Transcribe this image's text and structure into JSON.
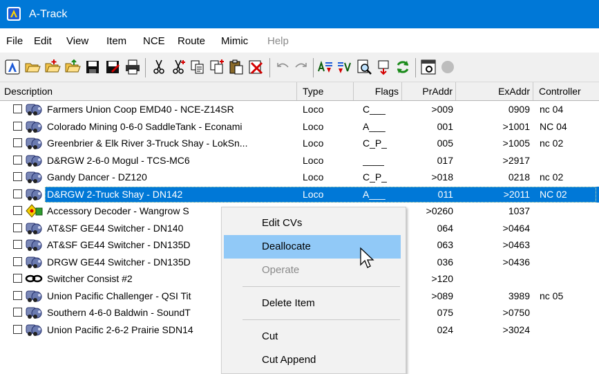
{
  "window": {
    "title": "A-Track"
  },
  "menu": [
    {
      "label": "File",
      "enabled": true
    },
    {
      "label": "Edit",
      "enabled": true
    },
    {
      "label": "View",
      "enabled": true
    },
    {
      "label": "Item",
      "enabled": true
    },
    {
      "label": "NCE",
      "enabled": true
    },
    {
      "label": "Route",
      "enabled": true
    },
    {
      "label": "Mimic",
      "enabled": true
    },
    {
      "label": "Help",
      "enabled": false
    }
  ],
  "toolbar": {
    "icons": [
      "app-icon",
      "open-folder-icon",
      "open-folder-add-icon",
      "open-folder-up-icon",
      "save-icon",
      "save-as-icon",
      "print-icon",
      "cut-icon",
      "cut-append-icon",
      "copy-icon",
      "copy-append-icon",
      "paste-icon",
      "delete-icon",
      "undo-icon",
      "redo-icon",
      "allocate-icon",
      "deallocate-icon",
      "find-icon",
      "locate-icon",
      "refresh-icon",
      "properties-icon",
      "status-icon"
    ]
  },
  "columns": {
    "description": "Description",
    "type": "Type",
    "flags": "Flags",
    "praddr": "PrAddr",
    "exaddr": "ExAddr",
    "controller": "Controller"
  },
  "rows": [
    {
      "icon": "locomotive-icon",
      "description": "Farmers Union Coop EMD40 - NCE-Z14SR",
      "type": "Loco",
      "flags": "C___",
      "praddr": ">009",
      "exaddr": "0909",
      "controller": "nc 04"
    },
    {
      "icon": "locomotive-icon",
      "description": "Colorado Mining 0-6-0 SaddleTank - Econami",
      "type": "Loco",
      "flags": "A___",
      "praddr": "001",
      "exaddr": ">1001",
      "controller": "NC 04"
    },
    {
      "icon": "locomotive-icon",
      "description": "Greenbrier & Elk River 3-Truck Shay - LokSn...",
      "type": "Loco",
      "flags": "C_P_",
      "praddr": "005",
      "exaddr": ">1005",
      "controller": "nc 02"
    },
    {
      "icon": "locomotive-icon",
      "description": "D&RGW 2-6-0 Mogul - TCS-MC6",
      "type": "Loco",
      "flags": "____",
      "praddr": "017",
      "exaddr": ">2917",
      "controller": ""
    },
    {
      "icon": "locomotive-icon",
      "description": "Gandy Dancer - DZ120",
      "type": "Loco",
      "flags": "C_P_",
      "praddr": ">018",
      "exaddr": "0218",
      "controller": "nc 02"
    },
    {
      "icon": "locomotive-icon",
      "description": "D&RGW 2-Truck Shay - DN142",
      "type": "Loco",
      "flags": "A___",
      "praddr": "011",
      "exaddr": ">2011",
      "controller": "NC 02",
      "selected": true
    },
    {
      "icon": "accessory-decoder-icon",
      "description": "Accessory Decoder - Wangrow S",
      "type": "",
      "flags": "",
      "praddr": ">0260",
      "exaddr": "1037",
      "controller": ""
    },
    {
      "icon": "locomotive-icon",
      "description": "AT&SF GE44 Switcher - DN140",
      "type": "",
      "flags": "",
      "praddr": "064",
      "exaddr": ">0464",
      "controller": ""
    },
    {
      "icon": "locomotive-icon",
      "description": "AT&SF GE44 Switcher - DN135D",
      "type": "",
      "flags": "",
      "praddr": "063",
      "exaddr": ">0463",
      "controller": ""
    },
    {
      "icon": "locomotive-icon",
      "description": "DRGW GE44 Switcher - DN135D",
      "type": "",
      "flags": "",
      "praddr": "036",
      "exaddr": ">0436",
      "controller": ""
    },
    {
      "icon": "consist-icon",
      "description": "Switcher Consist #2",
      "type": "",
      "flags": "",
      "praddr": ">120",
      "exaddr": "",
      "controller": ""
    },
    {
      "icon": "locomotive-icon",
      "description": "Union Pacific Challenger - QSI Tit",
      "type": "",
      "flags": "",
      "praddr": ">089",
      "exaddr": "3989",
      "controller": "nc 05"
    },
    {
      "icon": "locomotive-icon",
      "description": "Southern 4-6-0 Baldwin - SoundT",
      "type": "",
      "flags": "",
      "praddr": "075",
      "exaddr": ">0750",
      "controller": ""
    },
    {
      "icon": "locomotive-icon",
      "description": "Union Pacific 2-6-2 Prairie SDN14",
      "type": "",
      "flags": "",
      "praddr": "024",
      "exaddr": ">3024",
      "controller": ""
    }
  ],
  "context_menu": {
    "items": [
      {
        "label": "Edit CVs",
        "enabled": true,
        "highlighted": false
      },
      {
        "label": "Deallocate",
        "enabled": true,
        "highlighted": true
      },
      {
        "label": "Operate",
        "enabled": false,
        "highlighted": false
      },
      {
        "label": "Delete Item",
        "enabled": true,
        "highlighted": false
      },
      {
        "label": "Cut",
        "enabled": true,
        "highlighted": false
      },
      {
        "label": "Cut Append",
        "enabled": true,
        "highlighted": false
      }
    ]
  },
  "colors": {
    "titlebar": "#0078d7",
    "selection": "#0078d7",
    "menu_highlight": "#91c9f7"
  }
}
